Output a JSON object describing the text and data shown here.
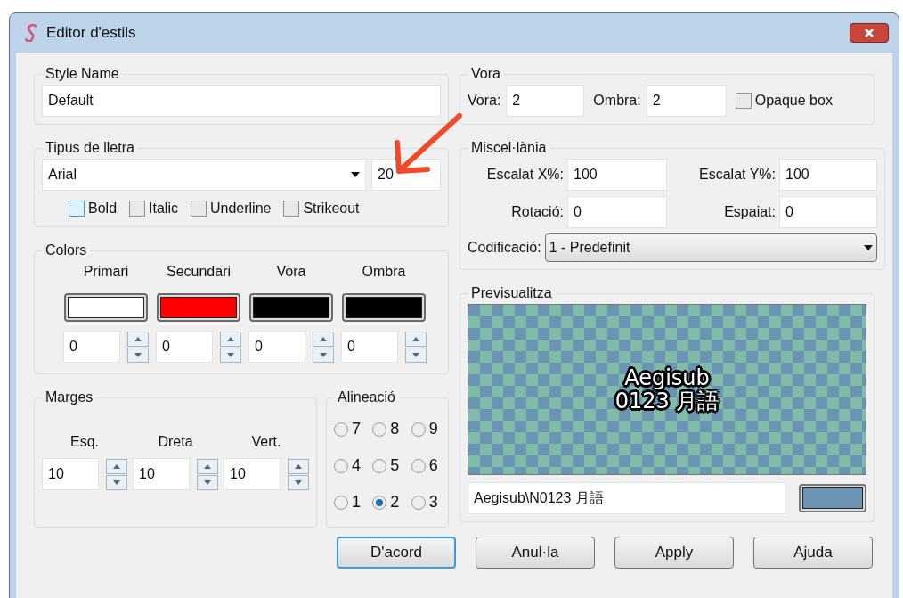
{
  "window": {
    "title": "Editor d'estils"
  },
  "style_name": {
    "label": "Style Name",
    "value": "Default"
  },
  "font": {
    "label": "Tipus de lletra",
    "family": "Arial",
    "size": "20",
    "options": [
      {
        "label": "Bold",
        "checked": false,
        "focused": true
      },
      {
        "label": "Italic",
        "checked": false,
        "focused": false
      },
      {
        "label": "Underline",
        "checked": false,
        "focused": false
      },
      {
        "label": "Strikeout",
        "checked": false,
        "focused": false
      }
    ]
  },
  "colors": {
    "label": "Colors",
    "items": [
      {
        "label": "Primari",
        "color": "#ffffff",
        "alpha": "0"
      },
      {
        "label": "Secundari",
        "color": "#ff0000",
        "alpha": "0"
      },
      {
        "label": "Vora",
        "color": "#000000",
        "alpha": "0"
      },
      {
        "label": "Ombra",
        "color": "#000000",
        "alpha": "0"
      }
    ]
  },
  "margins": {
    "label": "Marges",
    "items": [
      {
        "label": "Esq.",
        "value": "10"
      },
      {
        "label": "Dreta",
        "value": "10"
      },
      {
        "label": "Vert.",
        "value": "10"
      }
    ]
  },
  "alignment": {
    "label": "Alineació",
    "options": [
      {
        "label": "7",
        "selected": false
      },
      {
        "label": "8",
        "selected": false
      },
      {
        "label": "9",
        "selected": false
      },
      {
        "label": "4",
        "selected": false
      },
      {
        "label": "5",
        "selected": false
      },
      {
        "label": "6",
        "selected": false
      },
      {
        "label": "1",
        "selected": false
      },
      {
        "label": "2",
        "selected": true
      },
      {
        "label": "3",
        "selected": false
      }
    ]
  },
  "border": {
    "label": "Vora",
    "outline_label": "Vora:",
    "outline": "2",
    "shadow_label": "Ombra:",
    "shadow": "2",
    "opaque_box": {
      "label": "Opaque box",
      "checked": false
    }
  },
  "misc": {
    "label": "Miscel·lània",
    "fields": [
      {
        "label": "Escalat X%:",
        "value": "100"
      },
      {
        "label": "Escalat Y%:",
        "value": "100"
      },
      {
        "label": "Rotació:",
        "value": "0"
      },
      {
        "label": "Espaiat:",
        "value": "0"
      }
    ],
    "encoding_label": "Codificació:",
    "encoding": "1 - Predefinit"
  },
  "preview": {
    "label": "Previsualitza",
    "lines": [
      "Aegisub",
      "0123 月語"
    ],
    "text": "Aegisub\\N0123 月語",
    "background_swatch": {
      "color": "#6b93b3"
    }
  },
  "buttons": [
    {
      "label": "D'acord",
      "default": true
    },
    {
      "label": "Anul·la",
      "default": false
    },
    {
      "label": "Apply",
      "default": false
    },
    {
      "label": "Ajuda",
      "default": false
    }
  ]
}
